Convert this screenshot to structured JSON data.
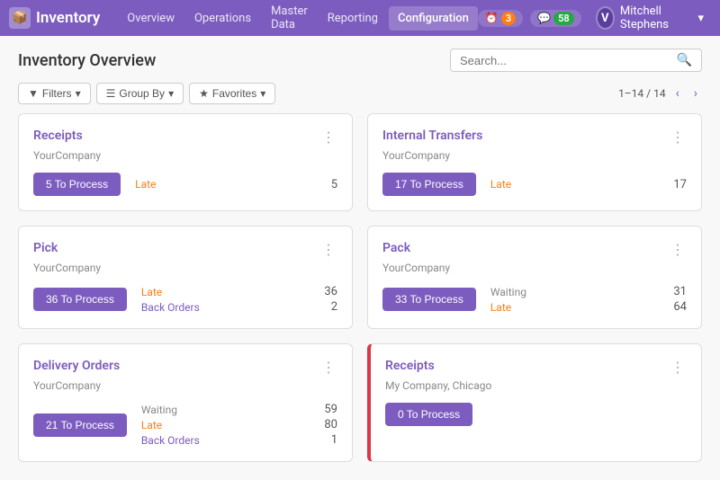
{
  "app": {
    "brand_icon": "📦",
    "brand_label": "Inventory"
  },
  "nav": {
    "links": [
      {
        "id": "overview",
        "label": "Overview",
        "active": false
      },
      {
        "id": "operations",
        "label": "Operations",
        "active": false
      },
      {
        "id": "master-data",
        "label": "Master Data",
        "active": false
      },
      {
        "id": "reporting",
        "label": "Reporting",
        "active": false
      },
      {
        "id": "configuration",
        "label": "Configuration",
        "active": true
      }
    ]
  },
  "badges": {
    "clock_icon": "⏰",
    "clock_count": "3",
    "chat_icon": "💬",
    "chat_count": "58"
  },
  "user": {
    "initial": "V",
    "name": "Mitchell Stephens",
    "caret": "▾"
  },
  "page": {
    "title": "Inventory Overview",
    "search_placeholder": "Search...",
    "filter_label": "Filters",
    "group_label": "Group By",
    "favorites_label": "Favorites",
    "pagination": "1–14 / 14"
  },
  "cards": [
    {
      "id": "receipts",
      "title": "Receipts",
      "company": "YourCompany",
      "btn_count": 5,
      "btn_suffix": "To Process",
      "red_border": false,
      "stats": [
        {
          "label": "Late",
          "label_class": "orange",
          "value": "5"
        }
      ]
    },
    {
      "id": "internal-transfers",
      "title": "Internal Transfers",
      "company": "YourCompany",
      "btn_count": 17,
      "btn_suffix": "To Process",
      "red_border": false,
      "stats": [
        {
          "label": "Late",
          "label_class": "orange",
          "value": "17"
        }
      ]
    },
    {
      "id": "pick",
      "title": "Pick",
      "company": "YourCompany",
      "btn_count": 36,
      "btn_suffix": "To Process",
      "red_border": false,
      "stats": [
        {
          "label": "Late",
          "label_class": "orange",
          "value": "36"
        },
        {
          "label": "Back Orders",
          "label_class": "purple",
          "value": "2"
        }
      ]
    },
    {
      "id": "pack",
      "title": "Pack",
      "company": "YourCompany",
      "btn_count": 33,
      "btn_suffix": "To Process",
      "red_border": false,
      "stats": [
        {
          "label": "Waiting",
          "label_class": "gray",
          "value": "31"
        },
        {
          "label": "Late",
          "label_class": "orange",
          "value": "64"
        }
      ]
    },
    {
      "id": "delivery-orders",
      "title": "Delivery Orders",
      "company": "YourCompany",
      "btn_count": 21,
      "btn_suffix": "To Process",
      "red_border": false,
      "stats": [
        {
          "label": "Waiting",
          "label_class": "gray",
          "value": "59"
        },
        {
          "label": "Late",
          "label_class": "orange",
          "value": "80"
        },
        {
          "label": "Back Orders",
          "label_class": "purple",
          "value": "1"
        }
      ]
    },
    {
      "id": "receipts-chicago",
      "title": "Receipts",
      "company": "My Company, Chicago",
      "btn_count": 0,
      "btn_suffix": "To Process",
      "red_border": true,
      "stats": []
    }
  ]
}
